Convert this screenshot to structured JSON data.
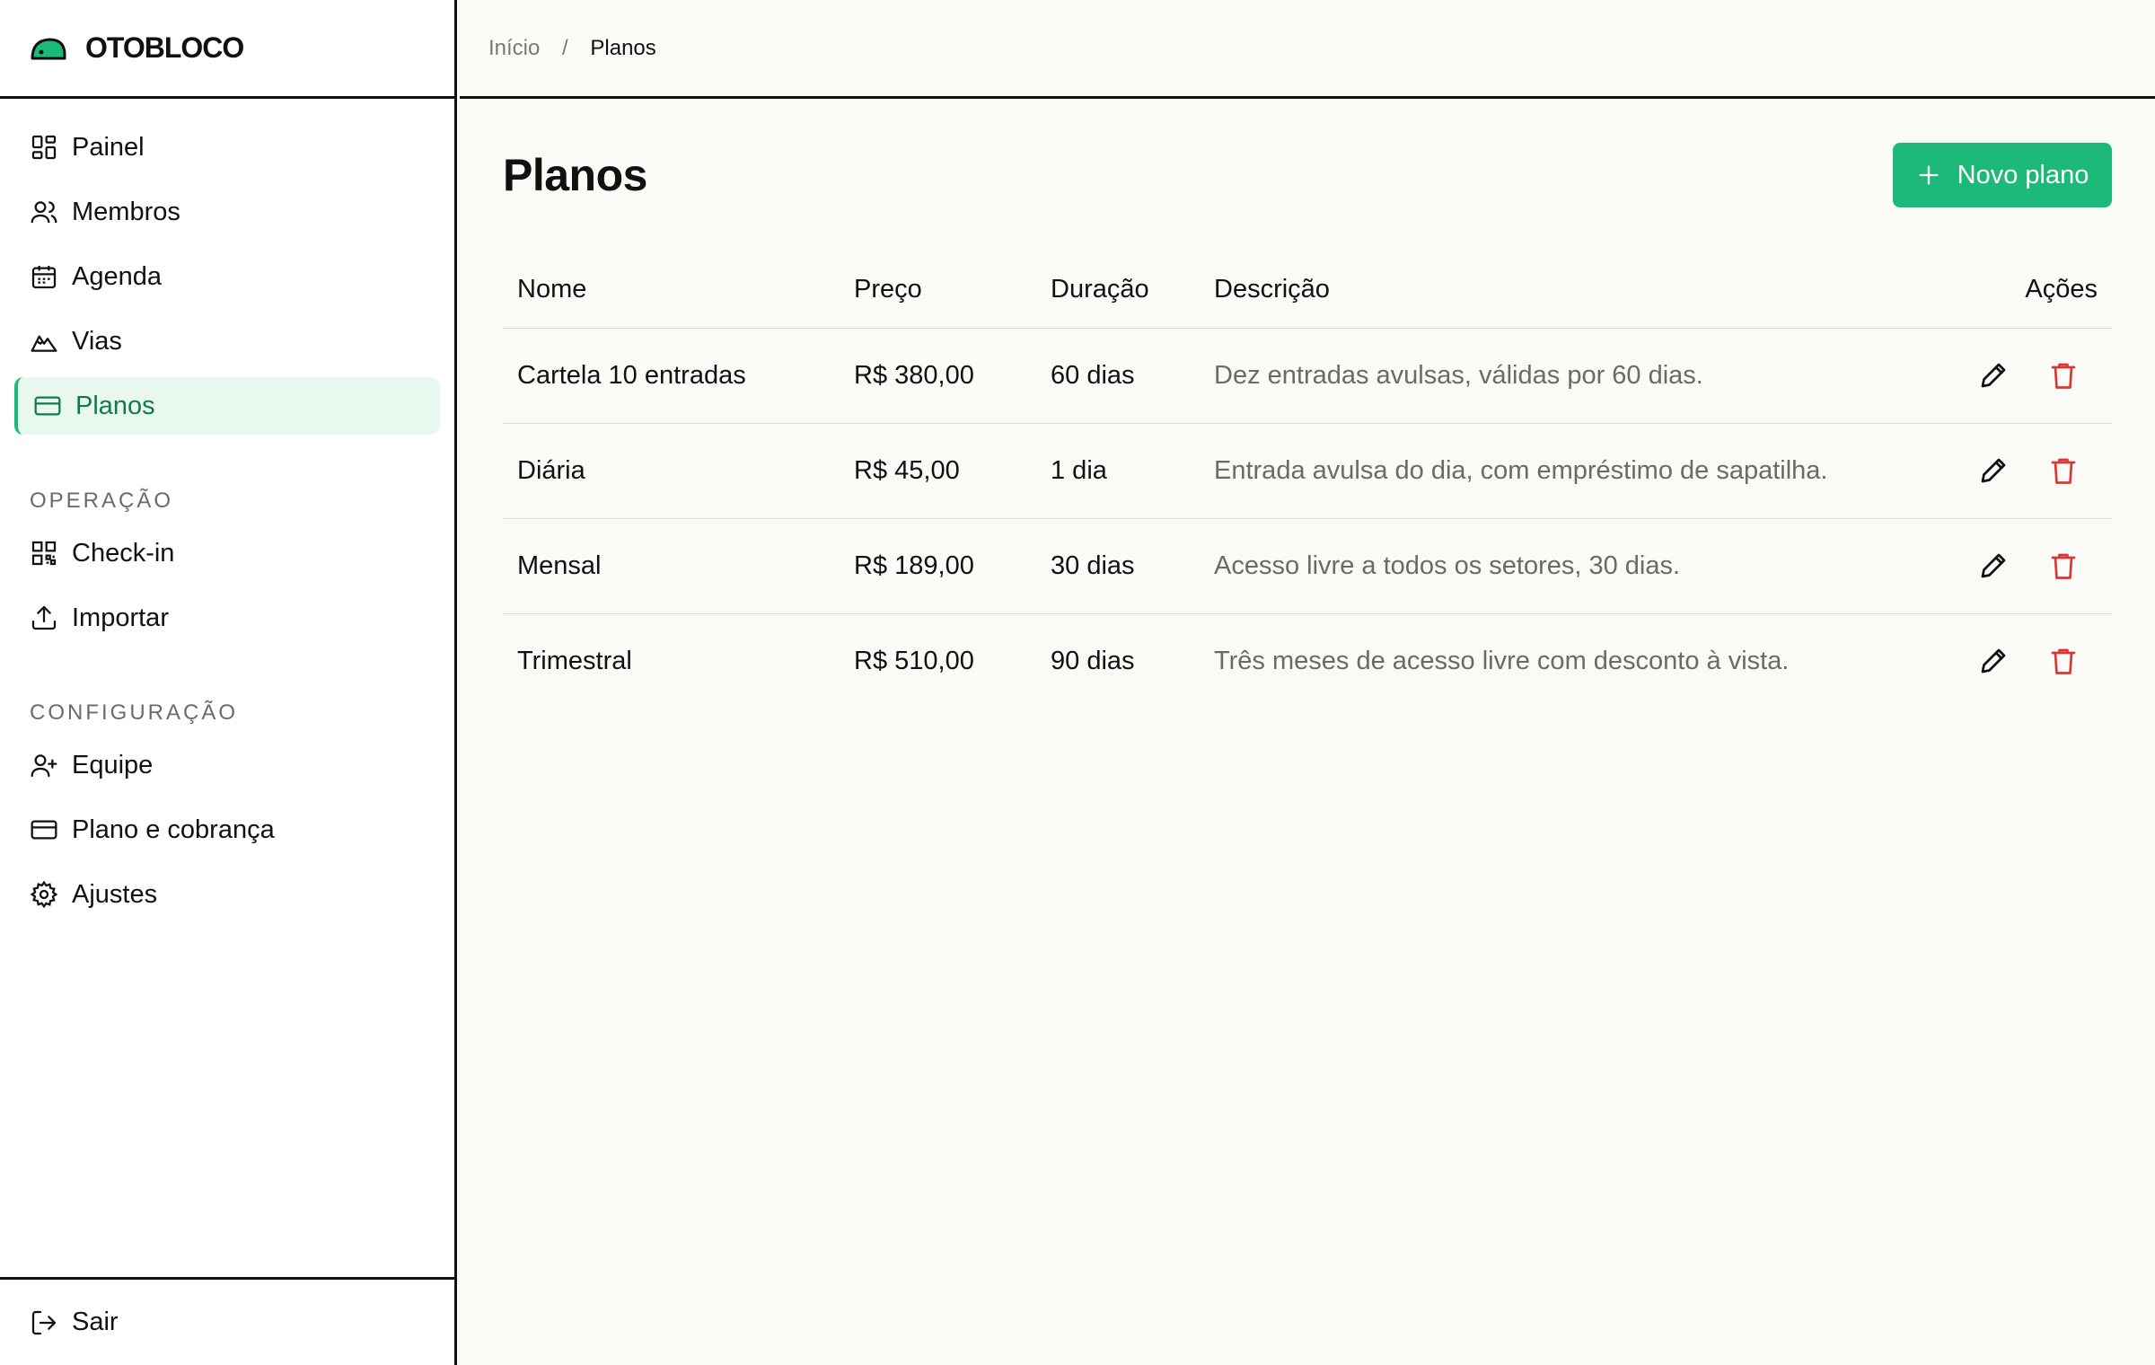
{
  "brand": {
    "name": "OTOBLOCO",
    "accent": "#1db978"
  },
  "sidebar": {
    "main_items": [
      {
        "label": "Painel",
        "icon": "dashboard-icon"
      },
      {
        "label": "Membros",
        "icon": "users-icon"
      },
      {
        "label": "Agenda",
        "icon": "calendar-icon"
      },
      {
        "label": "Vias",
        "icon": "mountain-icon"
      },
      {
        "label": "Planos",
        "icon": "card-icon",
        "active": true
      }
    ],
    "section_operacao": "OPERAÇÃO",
    "operacao_items": [
      {
        "label": "Check-in",
        "icon": "qr-icon"
      },
      {
        "label": "Importar",
        "icon": "upload-icon"
      }
    ],
    "section_config": "CONFIGURAÇÃO",
    "config_items": [
      {
        "label": "Equipe",
        "icon": "user-plus-icon"
      },
      {
        "label": "Plano e cobrança",
        "icon": "card-icon"
      },
      {
        "label": "Ajustes",
        "icon": "gear-icon"
      }
    ],
    "logout_label": "Sair"
  },
  "breadcrumb": {
    "home": "Início",
    "separator": "/",
    "current": "Planos"
  },
  "page": {
    "title": "Planos",
    "new_button": "Novo plano"
  },
  "table": {
    "headers": {
      "name": "Nome",
      "price": "Preço",
      "duration": "Duração",
      "description": "Descrição",
      "actions": "Ações"
    },
    "rows": [
      {
        "name": "Cartela 10 entradas",
        "price": "R$ 380,00",
        "duration": "60 dias",
        "description": "Dez entradas avulsas, válidas por 60 dias."
      },
      {
        "name": "Diária",
        "price": "R$ 45,00",
        "duration": "1 dia",
        "description": "Entrada avulsa do dia, com empréstimo de sapatilha."
      },
      {
        "name": "Mensal",
        "price": "R$ 189,00",
        "duration": "30 dias",
        "description": "Acesso livre a todos os setores, 30 dias."
      },
      {
        "name": "Trimestral",
        "price": "R$ 510,00",
        "duration": "90 dias",
        "description": "Três meses de acesso livre com desconto à vista."
      }
    ]
  },
  "colors": {
    "delete": "#d63838",
    "active_bg": "#e8f8ef"
  }
}
